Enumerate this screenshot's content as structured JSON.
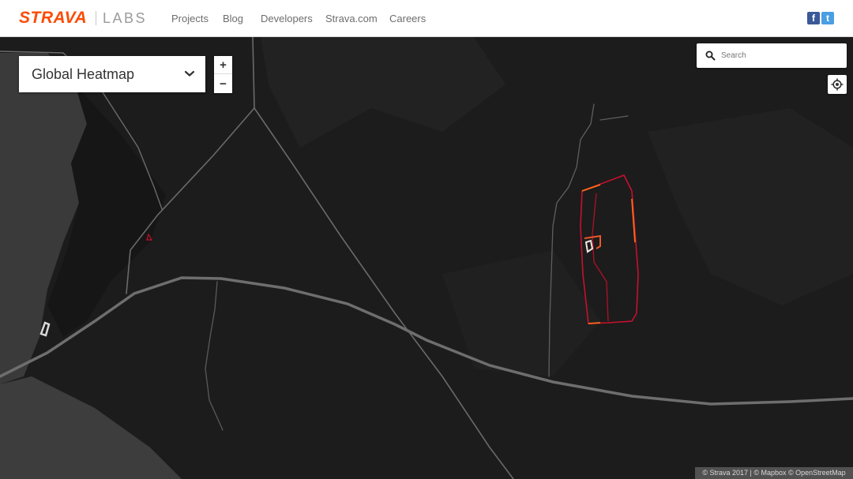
{
  "header": {
    "brand": "STRAVA",
    "labs": "LABS",
    "nav": [
      "Projects",
      "Blog",
      "Developers",
      "Strava.com",
      "Careers"
    ],
    "social": {
      "facebook_glyph": "f",
      "twitter_glyph": "t",
      "facebook_color": "#3b5998",
      "twitter_color": "#4a9ee3"
    }
  },
  "map_controls": {
    "map_type": "Global Heatmap",
    "zoom_in": "+",
    "zoom_out": "−",
    "search_placeholder": "Search"
  },
  "attribution": "© Strava 2017 | © Mapbox © OpenStreetMap",
  "colors": {
    "brand": "#fc4c02",
    "map_background": "#1b1b1b",
    "road": "#6a6a6a",
    "heat_red": "#c8102e",
    "heat_orange": "#ff6a1a"
  },
  "icons": [
    "chevron-down-icon",
    "search-icon",
    "locate-icon",
    "facebook-icon",
    "twitter-icon"
  ]
}
